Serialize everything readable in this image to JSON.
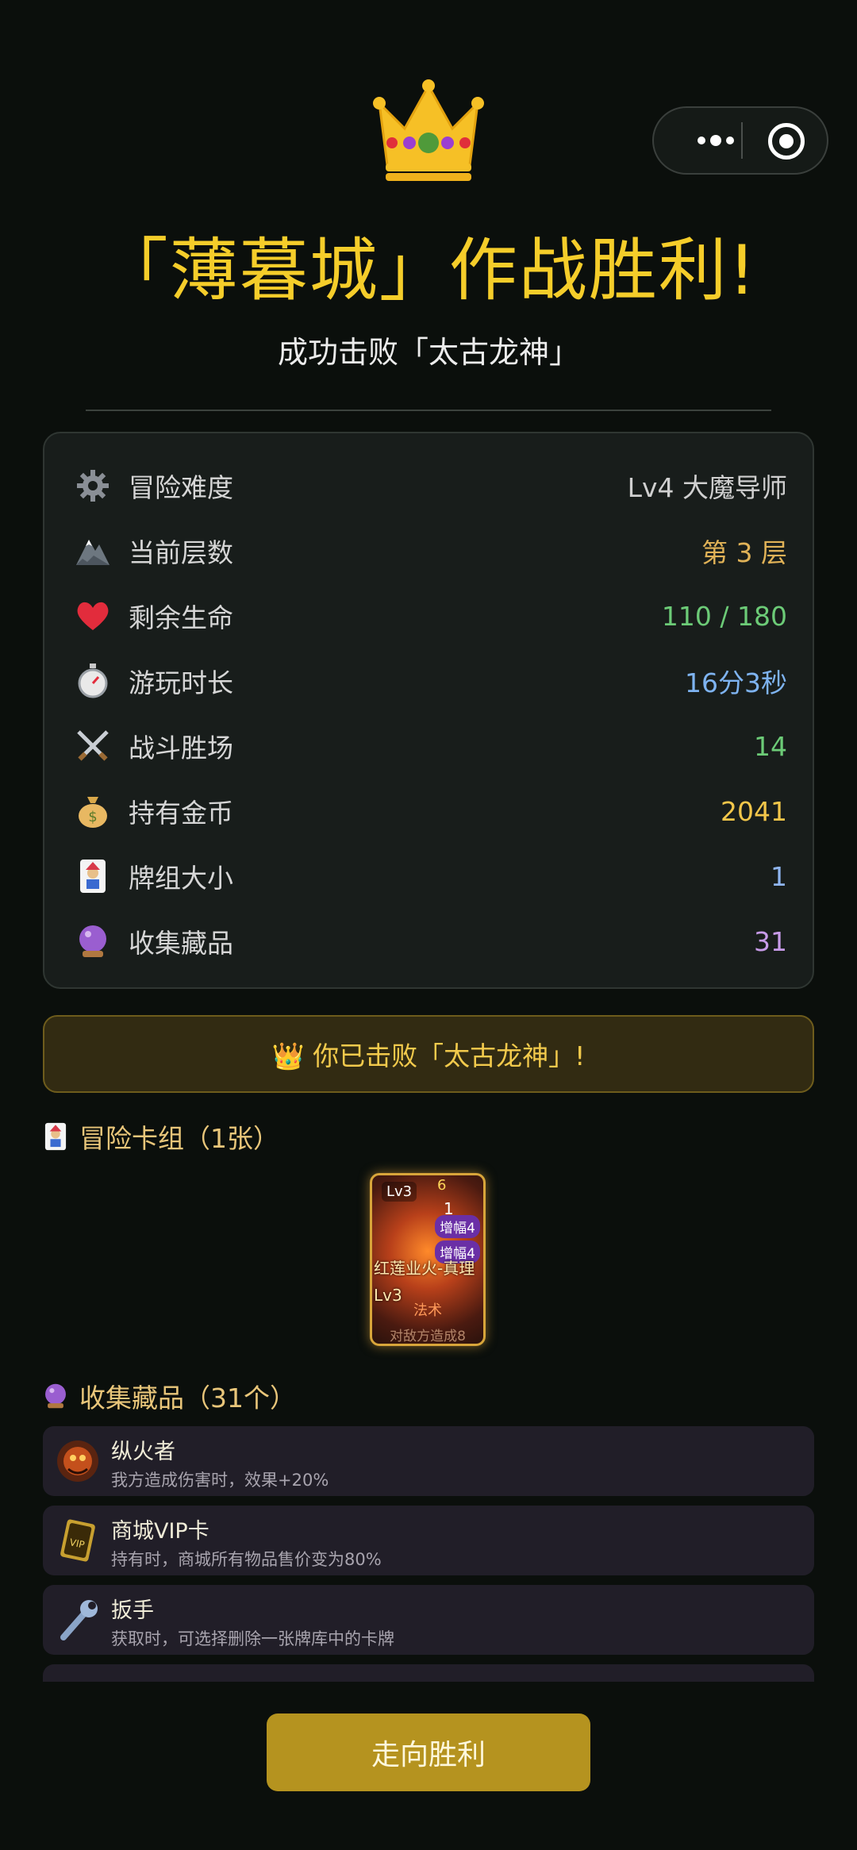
{
  "header": {
    "title": "「薄暮城」作战胜利!",
    "subtitle": "成功击败「太古龙神」"
  },
  "capsule": {
    "more_icon": "more-dots-icon",
    "close_icon": "target-icon"
  },
  "stats": [
    {
      "icon": "gear-icon",
      "label": "冒险难度",
      "value": "Lv4 大魔导师",
      "color": "#cfcfcf"
    },
    {
      "icon": "mountain-icon",
      "label": "当前层数",
      "value": "第 3 层",
      "color": "#e0b257"
    },
    {
      "icon": "heart-icon",
      "label": "剩余生命",
      "value": "110 / 180",
      "color": "#6ccb77"
    },
    {
      "icon": "stopwatch-icon",
      "label": "游玩时长",
      "value": "16分3秒",
      "color": "#7eb3f0"
    },
    {
      "icon": "crossed-swords-icon",
      "label": "战斗胜场",
      "value": "14",
      "color": "#6ccb77"
    },
    {
      "icon": "money-bag-icon",
      "label": "持有金币",
      "value": "2041",
      "color": "#f2c64a"
    },
    {
      "icon": "joker-card-icon",
      "label": "牌组大小",
      "value": "1",
      "color": "#8fb5f0"
    },
    {
      "icon": "crystal-ball-icon",
      "label": "收集藏品",
      "value": "31",
      "color": "#c79be8"
    }
  ],
  "banner": {
    "text": "👑 你已击败「太古龙神」!"
  },
  "deck": {
    "title": "冒险卡组（1张）",
    "card": {
      "level": "Lv3",
      "cost": "6",
      "count": "1",
      "tags": [
        "增幅4",
        "增幅4"
      ],
      "name": "红莲业火-真理Lv3",
      "type": "法术",
      "desc": "对敌方造成8"
    }
  },
  "relics": {
    "title": "收集藏品（31个）",
    "items": [
      {
        "icon": "fire-monster-icon",
        "name": "纵火者",
        "desc": "我方造成伤害时，效果+20%"
      },
      {
        "icon": "vip-card-icon",
        "name": "商城VIP卡",
        "desc": "持有时，商城所有物品售价变为80%"
      },
      {
        "icon": "wrench-icon",
        "name": "扳手",
        "desc": "获取时，可选择删除一张牌库中的卡牌"
      },
      {
        "icon": "relic-icon",
        "name": "",
        "desc": ""
      }
    ]
  },
  "footer": {
    "button": "走向胜利"
  },
  "colors": {
    "title": "#f5cd2a",
    "button": "#b5931f",
    "banner_bg": "#322b12"
  }
}
